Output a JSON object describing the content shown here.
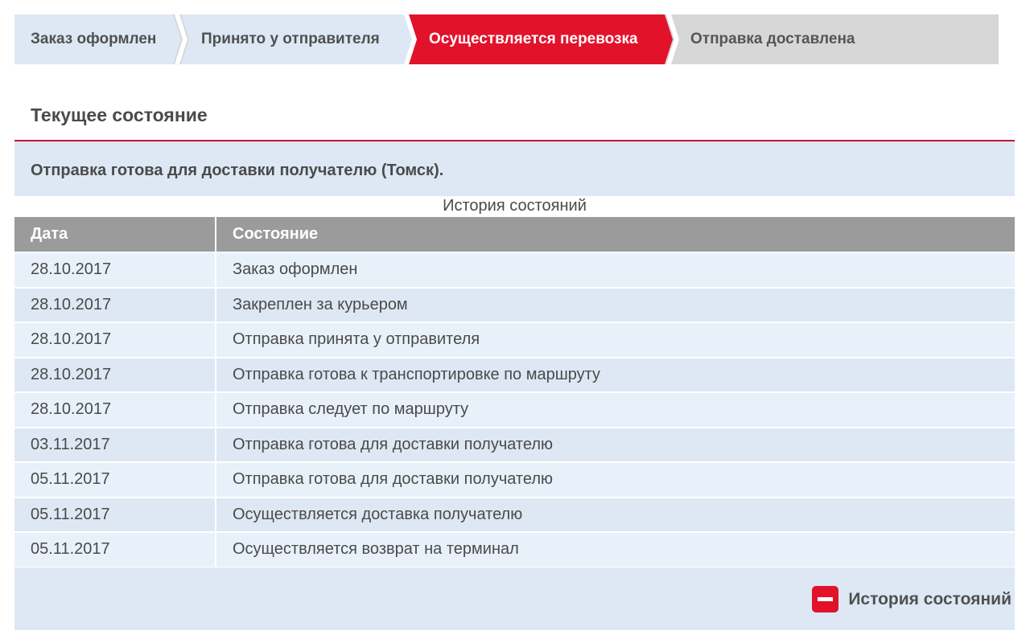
{
  "steps": [
    {
      "label": "Заказ оформлен",
      "status": "done"
    },
    {
      "label": "Принято у отправителя",
      "status": "done"
    },
    {
      "label": "Осуществляется перевозка",
      "status": "active"
    },
    {
      "label": "Отправка доставлена",
      "status": "todo"
    }
  ],
  "current": {
    "title": "Текущее состояние",
    "text": "Отправка готова для доставки получателю (Томск)."
  },
  "history": {
    "caption": "История состояний",
    "headers": {
      "date": "Дата",
      "state": "Состояние"
    },
    "rows": [
      {
        "date": "28.10.2017",
        "state": "Заказ оформлен"
      },
      {
        "date": "28.10.2017",
        "state": "Закреплен за курьером"
      },
      {
        "date": "28.10.2017",
        "state": "Отправка принята у отправителя"
      },
      {
        "date": "28.10.2017",
        "state": "Отправка готова к транспортировке по маршруту"
      },
      {
        "date": "28.10.2017",
        "state": "Отправка следует по маршруту"
      },
      {
        "date": "03.11.2017",
        "state": "Отправка готова для доставки получателю"
      },
      {
        "date": "05.11.2017",
        "state": "Отправка готова для доставки получателю"
      },
      {
        "date": "05.11.2017",
        "state": "Осуществляется доставка получателю"
      },
      {
        "date": "05.11.2017",
        "state": "Осуществляется возврат на терминал"
      }
    ],
    "toggle_label": "История состояний",
    "toggle_icon": "minus-icon"
  },
  "colors": {
    "accent": "#e3122b",
    "header_bg": "#9b9b9b",
    "row_bg": "#e8f1fa",
    "row_alt_bg": "#dde8f4"
  }
}
